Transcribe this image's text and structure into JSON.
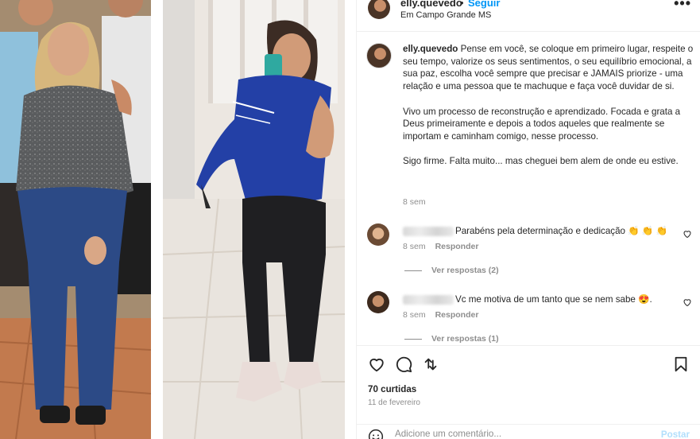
{
  "post": {
    "username": "elly.quevedo",
    "dot": "•",
    "follow_label": "Seguir",
    "location": "Em Campo Grande MS",
    "more_label": "•••",
    "caption": {
      "username": "elly.quevedo",
      "paragraph_1": "Pense em você, se coloque em primeiro lugar, respeite o seu tempo, valorize os seus sentimentos, o seu equilíbrio emocional, a sua paz, escolha você sempre que precisar e JAMAIS priorize - uma relação e uma pessoa que te machuque e faça você duvidar de si.",
      "paragraph_2": "Vivo um processo de reconstrução e aprendizado. Focada e grata a Deus primeiramente e depois a todos aqueles que realmente se importam e caminham comigo, nesse processo.",
      "paragraph_3": "Sigo firme. Falta muito... mas cheguei bem alem de onde eu estive.",
      "time": "8 sem"
    },
    "comments": [
      {
        "text": "Parabéns pela determinação e dedicação 👏 👏 👏",
        "time": "8 sem",
        "reply_label": "Responder",
        "view_replies": "Ver respostas (2)"
      },
      {
        "text": "Vc me motiva de um tanto que se nem sabe 😍.",
        "time": "8 sem",
        "reply_label": "Responder",
        "view_replies": "Ver respostas (1)"
      }
    ],
    "likes": "70 curtidas",
    "date": "11 de fevereiro",
    "comment_placeholder": "Adicione um comentário...",
    "post_button": "Postar",
    "icons": [
      "heart-icon",
      "comment-icon",
      "share-icon",
      "bookmark-icon",
      "emoji-icon"
    ],
    "colors": {
      "link": "#0095f6",
      "muted": "#8e8e8e",
      "post_disabled": "#b2dffc"
    }
  }
}
